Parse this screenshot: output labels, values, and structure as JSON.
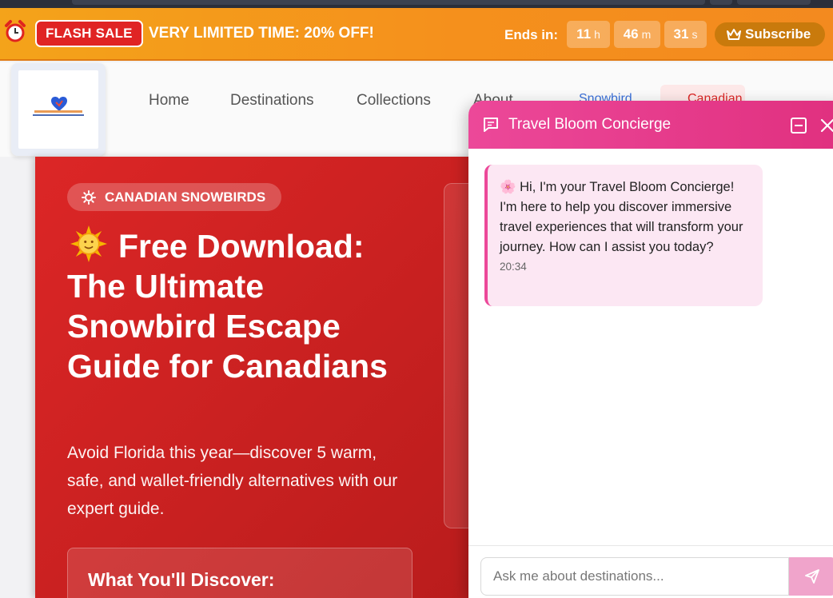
{
  "flash_bar": {
    "badge": "FLASH SALE",
    "message": "VERY LIMITED TIME:  20% OFF!",
    "ends_label": "Ends in:",
    "countdown": [
      {
        "value": "11",
        "unit": "h"
      },
      {
        "value": "46",
        "unit": "m"
      },
      {
        "value": "31",
        "unit": "s"
      }
    ],
    "subscribe_label": "Subscribe",
    "colors": {
      "bar": "#f5901c",
      "badge": "#e02424"
    }
  },
  "nav": {
    "links": [
      "Home",
      "Destinations",
      "Collections",
      "About"
    ],
    "snowbird": "Snowbird",
    "canadian": "Canadian"
  },
  "hero": {
    "badge": "CANADIAN SNOWBIRDS",
    "title": "Free Download: The Ultimate Snowbird Escape Guide for Canadians",
    "subtitle": "Avoid Florida this year—discover 5 warm, safe, and wallet-friendly alternatives with our expert guide.",
    "discover_heading": "What You'll Discover:",
    "colors": {
      "background": "#dc2626"
    }
  },
  "chat": {
    "title": "Travel Bloom Concierge",
    "message": "🌸 Hi, I'm your Travel Bloom Concierge! I'm here to help you discover immersive travel experiences that will transform your journey. How can I assist you today?",
    "time": "20:34",
    "input_placeholder": "Ask me about destinations...",
    "colors": {
      "header": "#ec4899",
      "bubble": "#fce7f3"
    }
  }
}
